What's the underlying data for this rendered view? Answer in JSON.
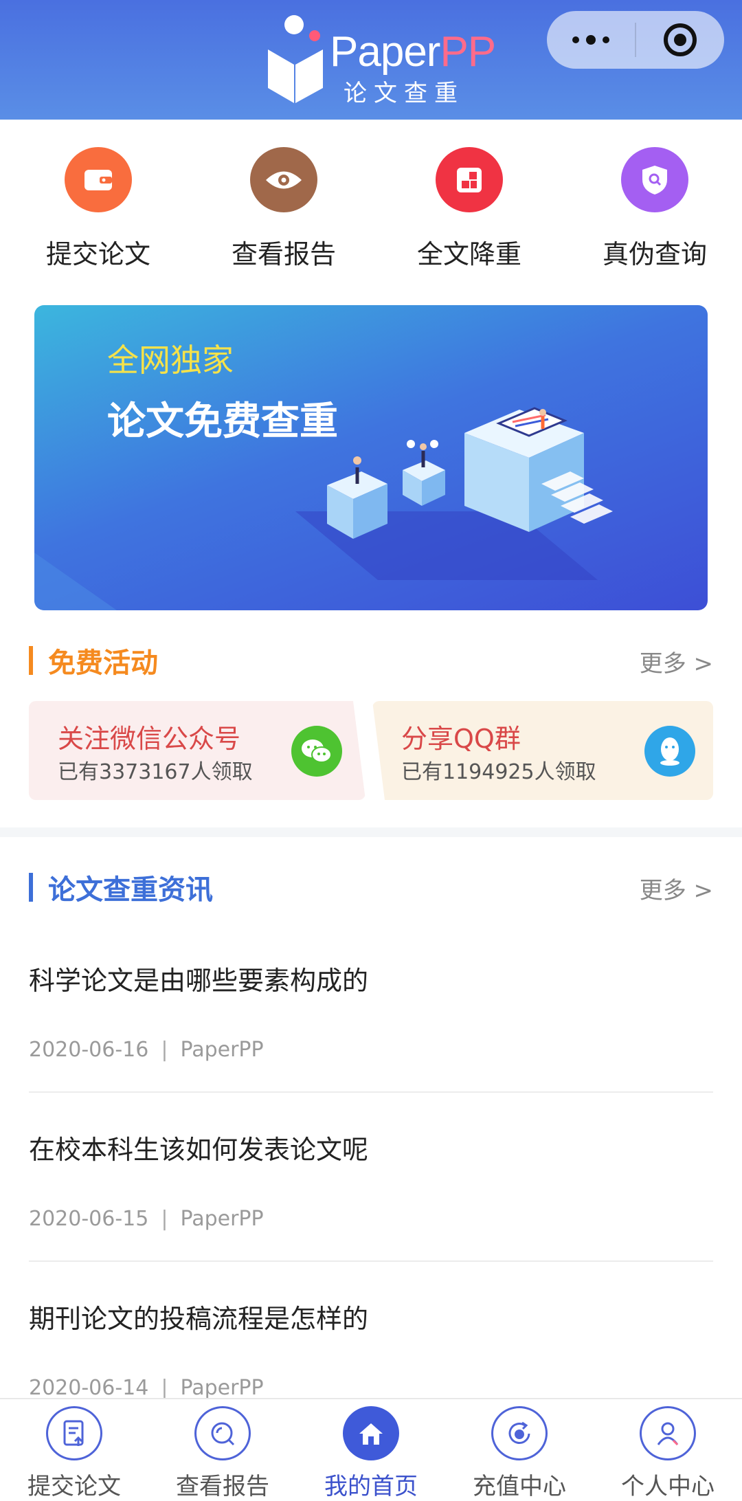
{
  "header": {
    "logo_main": "Paper",
    "logo_pp": "PP",
    "logo_sub": "论文查重"
  },
  "quick_menu": [
    {
      "label": "提交论文",
      "icon": "wallet-icon",
      "color": "#f96d3e"
    },
    {
      "label": "查看报告",
      "icon": "eye-icon",
      "color": "#a0684a"
    },
    {
      "label": "全文降重",
      "icon": "blocks-icon",
      "color": "#f03343"
    },
    {
      "label": "真伪查询",
      "icon": "shield-search-icon",
      "color": "#a45ff2"
    }
  ],
  "banner": {
    "tag": "全网独家",
    "title": "论文免费查重"
  },
  "activities": {
    "title": "免费活动",
    "more": "更多 >",
    "accent": "#f58a1f",
    "cards": [
      {
        "title": "关注微信公众号",
        "sub": "已有3373167人领取",
        "icon": "wechat-icon",
        "title_color": "#d94848",
        "bg": "#fbeeee",
        "icon_color": "#4ec331"
      },
      {
        "title": "分享QQ群",
        "sub": "已有1194925人领取",
        "icon": "qq-icon",
        "title_color": "#d94848",
        "bg": "#fbf2e4",
        "icon_color": "#2fa6e8"
      }
    ]
  },
  "news": {
    "title": "论文查重资讯",
    "more": "更多 >",
    "accent": "#3d6fd8",
    "items": [
      {
        "title": "科学论文是由哪些要素构成的",
        "date": "2020-06-16",
        "source": "PaperPP"
      },
      {
        "title": "在校本科生该如何发表论文呢",
        "date": "2020-06-15",
        "source": "PaperPP"
      },
      {
        "title": "期刊论文的投稿流程是怎样的",
        "date": "2020-06-14",
        "source": "PaperPP"
      }
    ]
  },
  "tabbar": [
    {
      "label": "提交论文",
      "icon": "upload-doc-icon",
      "active": false
    },
    {
      "label": "查看报告",
      "icon": "search-report-icon",
      "active": false
    },
    {
      "label": "我的首页",
      "icon": "home-icon",
      "active": true
    },
    {
      "label": "充值中心",
      "icon": "recharge-icon",
      "active": false
    },
    {
      "label": "个人中心",
      "icon": "user-icon",
      "active": false
    }
  ]
}
